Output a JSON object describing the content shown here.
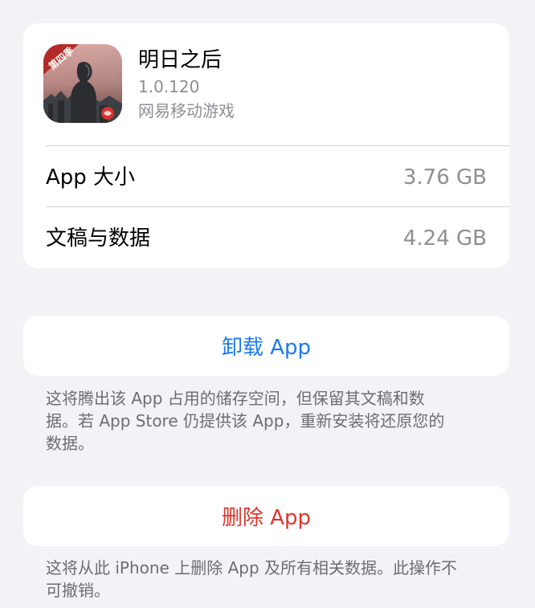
{
  "app": {
    "name": "明日之后",
    "version": "1.0.120",
    "developer": "网易移动游戏",
    "icon_badge": "第四季"
  },
  "storage": {
    "app_size_label": "App 大小",
    "app_size_value": "3.76 GB",
    "docs_label": "文稿与数据",
    "docs_value": "4.24 GB"
  },
  "offload": {
    "button_label": "卸载 App",
    "footnote_line1": "这将腾出该 App 占用的储存空间，但保留其文稿和数",
    "footnote_line2": "据。若 App Store 仍提供该 App，重新安装将还原您的",
    "footnote_line3": "数据。"
  },
  "delete": {
    "button_label": "删除 App",
    "footnote_line1": "这将从此 iPhone 上删除 App 及所有相关数据。此操作不",
    "footnote_line2": "可撤销。"
  },
  "colors": {
    "background": "#f2f2f7",
    "accent_blue": "#1a7bf1",
    "destructive_red": "#e0352b",
    "secondary_text": "#8e8e93"
  }
}
